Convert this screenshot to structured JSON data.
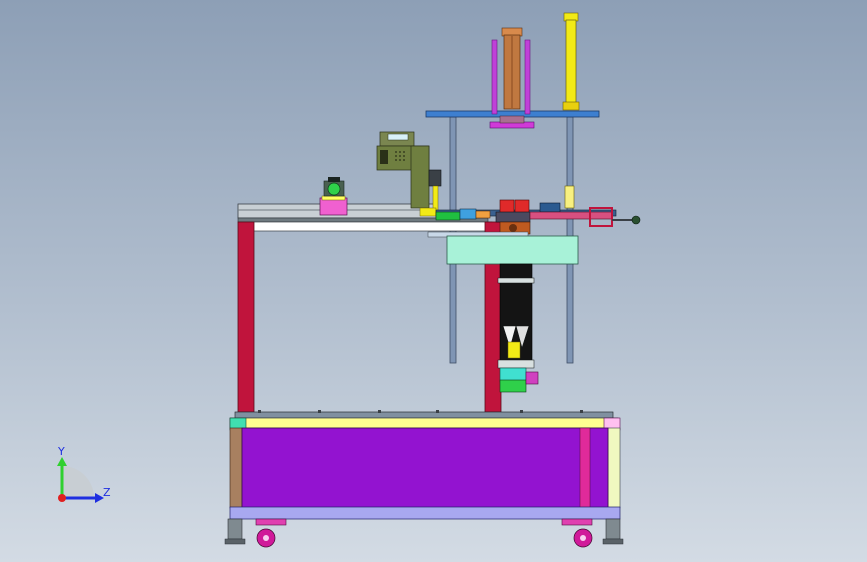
{
  "viewport": {
    "background_top": "#8d9fb6",
    "background_bottom": "#d3dbe4"
  },
  "triad": {
    "y_label": "Y",
    "z_label": "Z",
    "y_color": "#2fd02f",
    "z_color": "#1f2fe0",
    "origin_color": "#e01f1f"
  },
  "colors": {
    "frame_red": "#c0143c",
    "cabinet_purple": "#9313d0",
    "rail_gray": "#6f7a80",
    "top_plate_blue": "#3d7fd0",
    "cylinder_yellow": "#f2ea16",
    "cylinder_copper": "#c07840",
    "head_olive": "#6f7f40",
    "mint_block": "#a8f2d8",
    "caster_magenta": "#d01a9a"
  }
}
